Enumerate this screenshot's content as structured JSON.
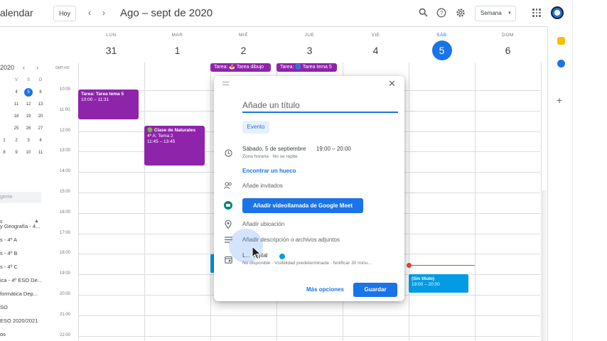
{
  "header": {
    "app_title": "alendar",
    "today_label": "Hoy",
    "period_title": "Ago – sept de 2020",
    "view_label": "Semana",
    "icons": [
      "search-icon",
      "help-icon",
      "settings-icon",
      "apps-grid-icon",
      "account-avatar"
    ]
  },
  "sidebar": {
    "mini_month": "2020",
    "mini_dow": [
      "V",
      "S",
      "D"
    ],
    "mini_rows": [
      [
        "4",
        "5",
        "6"
      ],
      [
        "11",
        "12",
        "13"
      ],
      [
        "18",
        "19",
        "20"
      ],
      [
        "25",
        "26",
        "27"
      ],
      [
        "2",
        "3",
        "4"
      ],
      [
        "9",
        "10",
        "11"
      ]
    ],
    "mini_lead": [
      "",
      "",
      "",
      "",
      "1",
      "8"
    ],
    "mini_selected": "5",
    "search_people": "gente",
    "section_label": "s",
    "calendars": [
      "y Geografía - 4...",
      "s - 4º A",
      "s - 4º B",
      "s - 4º C",
      "ica - 4º ESO De...",
      "formática Dep...",
      "SO",
      "ESO 2020/2021",
      "os"
    ]
  },
  "days": [
    {
      "dow": "LUN",
      "num": "31"
    },
    {
      "dow": "MAR",
      "num": "1"
    },
    {
      "dow": "MIÉ",
      "num": "2"
    },
    {
      "dow": "JUE",
      "num": "3"
    },
    {
      "dow": "VIE",
      "num": "4"
    },
    {
      "dow": "SÁB",
      "num": "5",
      "active": true
    },
    {
      "dow": "DOM",
      "num": "6"
    }
  ],
  "timezone_label": "GMT+02",
  "hours": [
    "10:00",
    "11:00",
    "12:00",
    "13:00",
    "14:00",
    "15:00",
    "16:00",
    "17:00",
    "18:00",
    "19:00",
    "20:00",
    "21:00",
    "22:00"
  ],
  "allday_events": [
    {
      "label": "Tarea: 🍝 Tarea dibujo"
    },
    {
      "label": "Tarea: 🌐 Tarea tema 5"
    }
  ],
  "events": [
    {
      "title": "Tarea: Tarea tema 5",
      "time": "10:00 – 11:31"
    },
    {
      "title": "🟢 Clase de Naturales",
      "line2": "4º A: Tema 2",
      "time": "11:45 – 13:45"
    },
    {
      "title": "(Sin título)",
      "time": "19:00 – 20:00"
    }
  ],
  "dialog": {
    "title_placeholder": "Añade un título",
    "type_chip": "Evento",
    "date_text": "Sábado, 5 de septiembre",
    "time_start": "19:00",
    "time_sep": "–",
    "time_end": "20:00",
    "timezone_text": "Zona horaria · No se repite",
    "find_slot": "Encontrar un hueco",
    "add_guests": "Añade invitados",
    "meet_button": "Añadir videollamada de Google Meet",
    "add_location": "Añadir ubicación",
    "add_description": "Añadir descripción o archivos adjuntos",
    "calendar_name": "L... Digital",
    "calendar_sub": "No disponible · Visibilidad predeterminada · Notificar 30 minu...",
    "more_options": "Más opciones",
    "save": "Guardar"
  },
  "colors": {
    "accent": "#1a73e8",
    "event_purple": "#8e24aa",
    "event_blue": "#039be5",
    "now_line": "#ea4335"
  }
}
